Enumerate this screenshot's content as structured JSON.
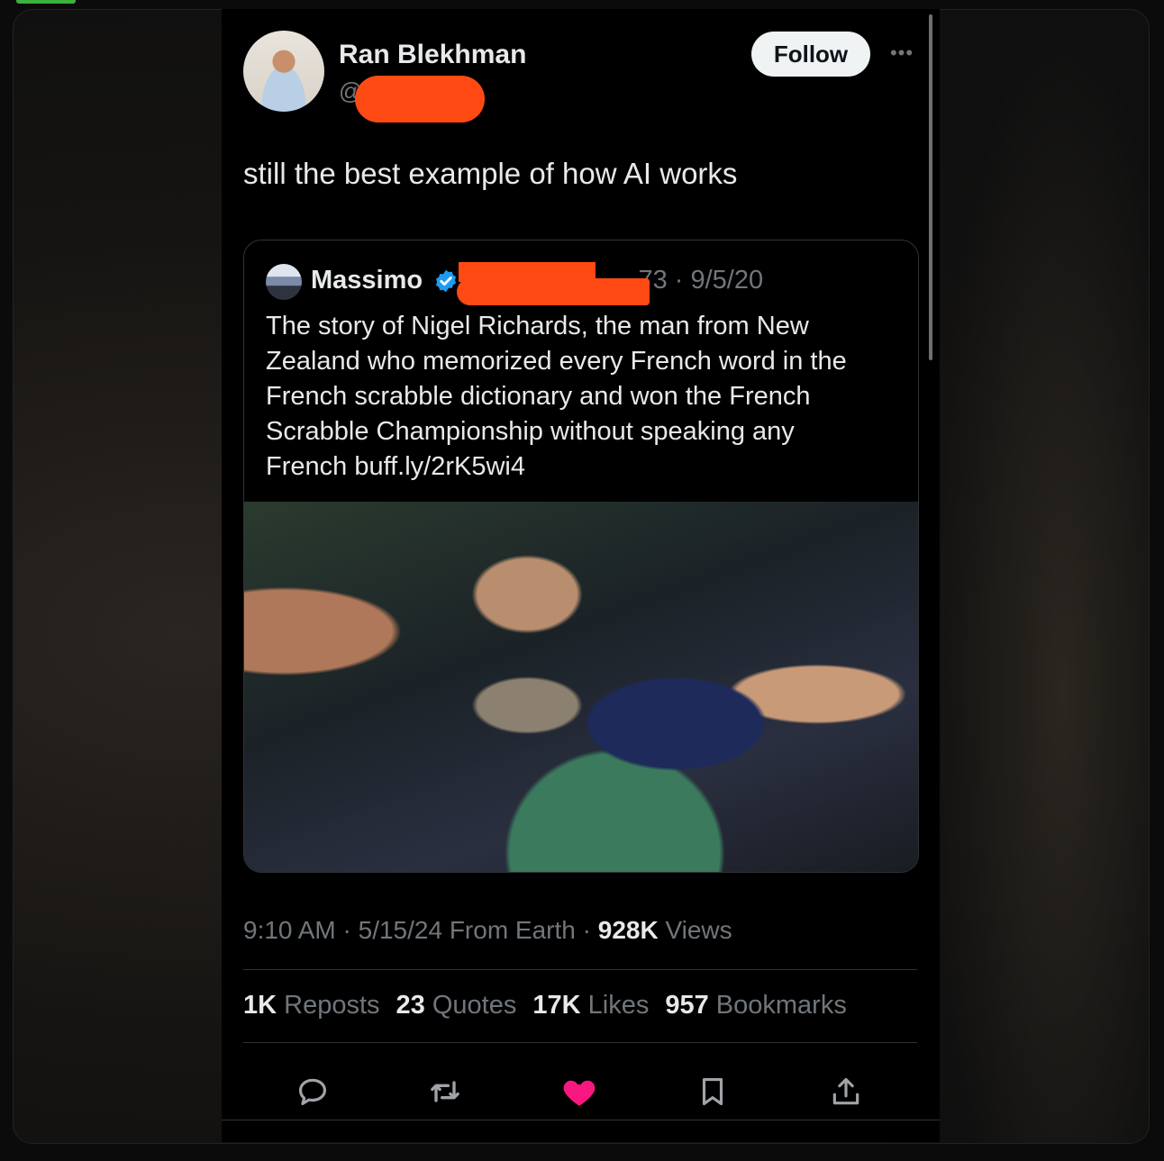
{
  "author": {
    "name": "Ran Blekhman",
    "handle": "@"
  },
  "follow_label": "Follow",
  "tweet": {
    "text": "still the best example of how AI works"
  },
  "quoted": {
    "name": "Massimo",
    "handle_prefix": "@",
    "meta": "73 · 9/5/20",
    "lines": [
      "The story of Nigel Richards, the man from New",
      "Zealand  who memorized every French word in the",
      "French scrabble dictionary and won the French",
      "Scrabble Championship without speaking any",
      "French buff.ly/2rK5wi4"
    ]
  },
  "meta": {
    "time": "9:10 AM",
    "date": "5/15/24",
    "source": "From Earth",
    "views_count": "928K",
    "views_label": "Views"
  },
  "stats": {
    "reposts_count": "1K",
    "reposts_label": "Reposts",
    "quotes_count": "23",
    "quotes_label": "Quotes",
    "likes_count": "17K",
    "likes_label": "Likes",
    "bookmarks_count": "957",
    "bookmarks_label": "Bookmarks"
  },
  "colors": {
    "like_active": "#f91880",
    "redaction": "#ff4a14",
    "verified": "#1d9bf0"
  }
}
